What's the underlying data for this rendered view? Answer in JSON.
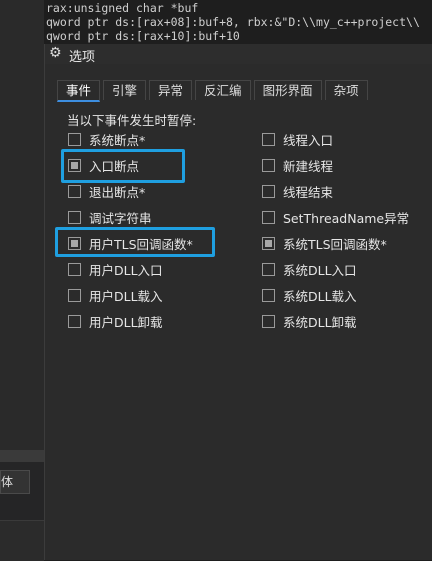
{
  "background": {
    "code_lines": [
      "rax:unsigned char *buf",
      "qword ptr ds:[rax+08]:buf+8, rbx:&\"D:\\\\my_c++project\\\\",
      "qword ptr ds:[rax+10]:buf+10"
    ],
    "side_label": "体"
  },
  "dialog": {
    "title": "选项",
    "title_icon": "gear-icon",
    "tabs": [
      {
        "label": "事件",
        "active": true
      },
      {
        "label": "引擎",
        "active": false
      },
      {
        "label": "异常",
        "active": false
      },
      {
        "label": "反汇编",
        "active": false
      },
      {
        "label": "图形界面",
        "active": false
      },
      {
        "label": "杂项",
        "active": false
      }
    ],
    "heading": "当以下事件发生时暂停:",
    "left_options": [
      {
        "label": "系统断点*",
        "checked": false
      },
      {
        "label": "入口断点",
        "checked": true
      },
      {
        "label": "退出断点*",
        "checked": false
      },
      {
        "label": "调试字符串",
        "checked": false
      },
      {
        "label": "用户TLS回调函数*",
        "checked": true
      },
      {
        "label": "用户DLL入口",
        "checked": false
      },
      {
        "label": "用户DLL载入",
        "checked": false
      },
      {
        "label": "用户DLL卸载",
        "checked": false
      }
    ],
    "right_options": [
      {
        "label": "线程入口",
        "checked": false
      },
      {
        "label": "新建线程",
        "checked": false
      },
      {
        "label": "线程结束",
        "checked": false
      },
      {
        "label": "SetThreadName异常",
        "checked": false
      },
      {
        "label": "系统TLS回调函数*",
        "checked": true
      },
      {
        "label": "系统DLL入口",
        "checked": false
      },
      {
        "label": "系统DLL载入",
        "checked": false
      },
      {
        "label": "系统DLL卸载",
        "checked": false
      }
    ],
    "highlight_color": "#1f9fe0"
  }
}
